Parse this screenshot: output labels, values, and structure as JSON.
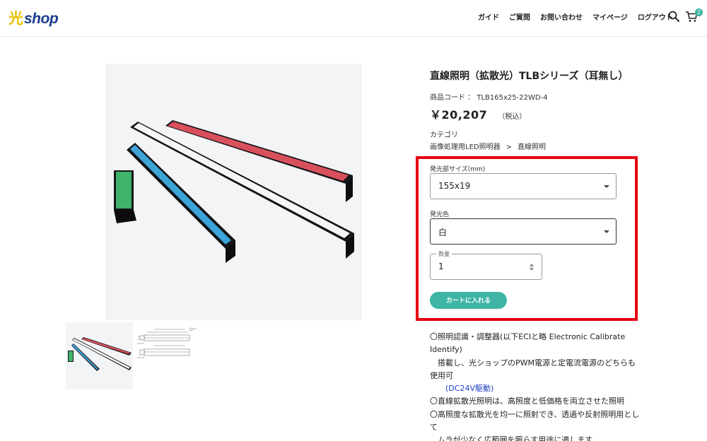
{
  "header": {
    "logo_kanji": "光",
    "logo_text": "shop",
    "nav": [
      "ガイド",
      "ご質問",
      "お問い合わせ",
      "マイページ",
      "ログアウト"
    ],
    "cart_count": "2",
    "icons": [
      "search-icon",
      "cart-icon"
    ]
  },
  "product": {
    "title": "直線照明（拡散光）TLBシリーズ（耳無し）",
    "code_label": "商品コード ：",
    "code": "TLB165x25-22WD-4",
    "price": "￥20,207",
    "tax": "（税込）",
    "category_label": "カテゴリ",
    "category_path": [
      "画像処理用LED照明器",
      "直線照明"
    ],
    "category_sep": ">"
  },
  "options": {
    "size_label": "発光部サイズ(mm)",
    "size_value": "155x19",
    "color_label": "発光色",
    "color_value": "白",
    "qty_label": "数量",
    "qty_value": "1",
    "cart_button": "カートに入れる"
  },
  "description": {
    "line1": "〇照明認識・調整器(以下ECIと略 Electronic Calibrate Identify)",
    "line2": "　搭載し、光ショップのPWM電源と定電流電源のどちらも使用可",
    "line3": "(DC24V駆動)",
    "line4": "〇直線拡散光照明は、高照度と低価格を両立させた照明",
    "line5": "〇高照度な拡散光を均一に照射でき、透過や反射照明用として",
    "line6": "　ムラが少なく広範囲を照らす用途に適します"
  },
  "colors": {
    "accent": "#3eb5a4",
    "highlight": "#e60012",
    "logo_blue": "#1a3c8f",
    "logo_yellow": "#e8c200",
    "link": "#1d3fbf"
  }
}
